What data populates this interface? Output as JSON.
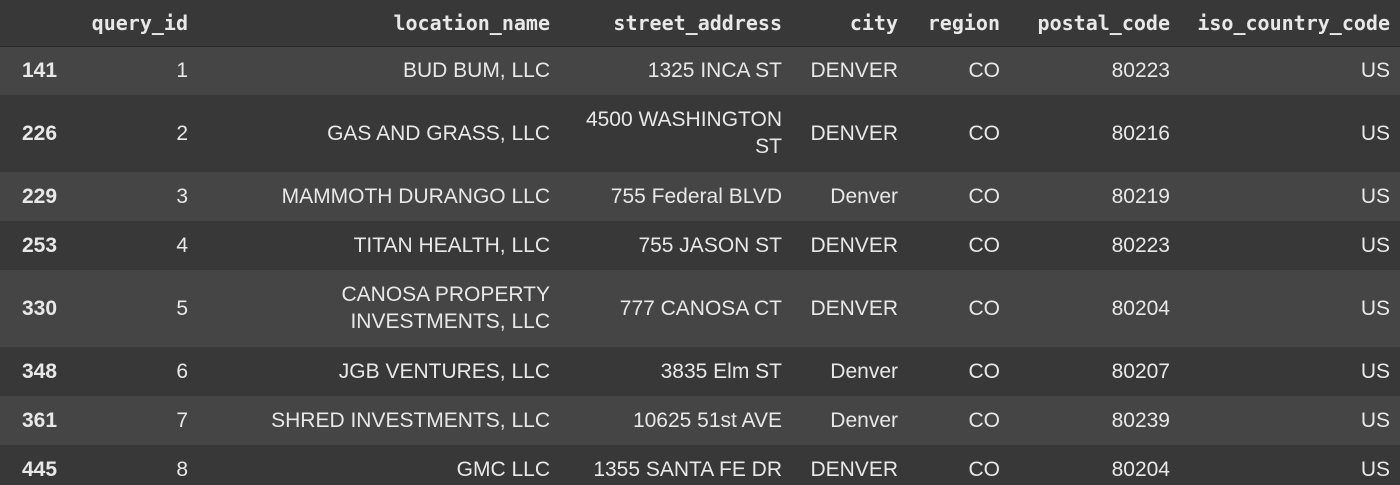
{
  "headers": [
    "",
    "query_id",
    "location_name",
    "street_address",
    "city",
    "region",
    "postal_code",
    "iso_country_code"
  ],
  "rows": [
    {
      "index": "141",
      "query_id": "1",
      "location_name": "BUD BUM, LLC",
      "street_address": "1325 INCA ST",
      "city": "DENVER",
      "region": "CO",
      "postal_code": "80223",
      "iso_country_code": "US"
    },
    {
      "index": "226",
      "query_id": "2",
      "location_name": "GAS AND GRASS, LLC",
      "street_address": "4500 WASHINGTON ST",
      "city": "DENVER",
      "region": "CO",
      "postal_code": "80216",
      "iso_country_code": "US"
    },
    {
      "index": "229",
      "query_id": "3",
      "location_name": "MAMMOTH DURANGO LLC",
      "street_address": "755 Federal BLVD",
      "city": "Denver",
      "region": "CO",
      "postal_code": "80219",
      "iso_country_code": "US"
    },
    {
      "index": "253",
      "query_id": "4",
      "location_name": "TITAN HEALTH, LLC",
      "street_address": "755 JASON ST",
      "city": "DENVER",
      "region": "CO",
      "postal_code": "80223",
      "iso_country_code": "US"
    },
    {
      "index": "330",
      "query_id": "5",
      "location_name": "CANOSA PROPERTY INVESTMENTS, LLC",
      "street_address": "777 CANOSA CT",
      "city": "DENVER",
      "region": "CO",
      "postal_code": "80204",
      "iso_country_code": "US"
    },
    {
      "index": "348",
      "query_id": "6",
      "location_name": "JGB VENTURES, LLC",
      "street_address": "3835 Elm ST",
      "city": "Denver",
      "region": "CO",
      "postal_code": "80207",
      "iso_country_code": "US"
    },
    {
      "index": "361",
      "query_id": "7",
      "location_name": "SHRED INVESTMENTS, LLC",
      "street_address": "10625 51st AVE",
      "city": "Denver",
      "region": "CO",
      "postal_code": "80239",
      "iso_country_code": "US"
    },
    {
      "index": "445",
      "query_id": "8",
      "location_name": "GMC LLC",
      "street_address": "1355 SANTA FE DR",
      "city": "DENVER",
      "region": "CO",
      "postal_code": "80204",
      "iso_country_code": "US"
    }
  ]
}
